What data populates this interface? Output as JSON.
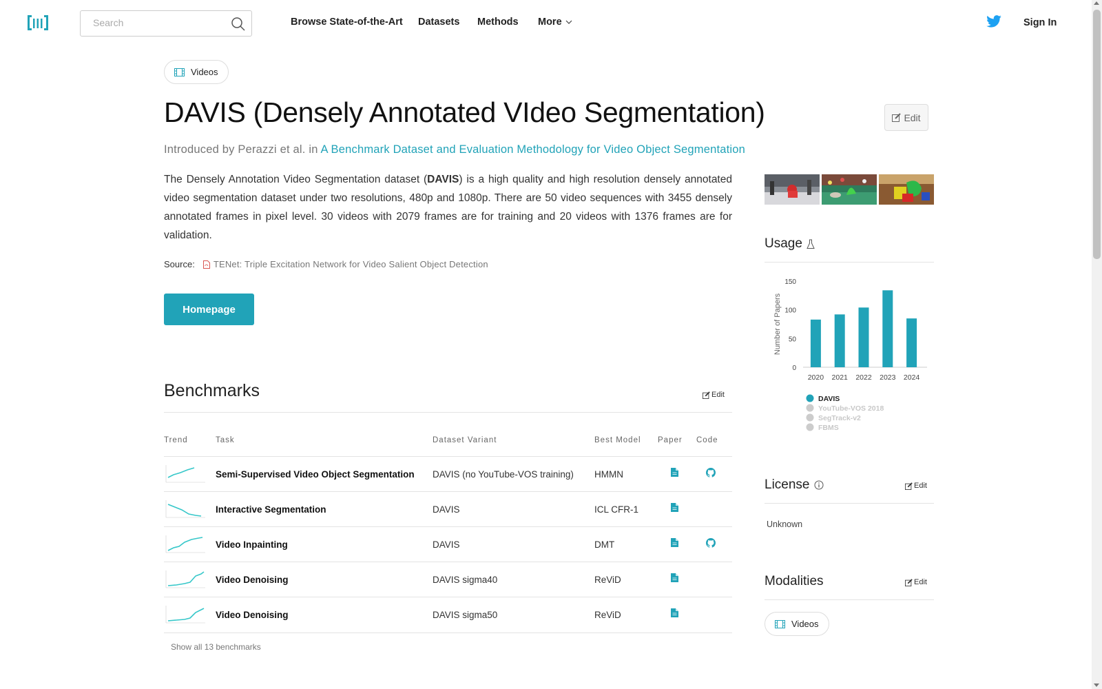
{
  "nav": {
    "search_placeholder": "Search",
    "links": [
      "Browse State-of-the-Art",
      "Datasets",
      "Methods",
      "More"
    ],
    "sign_in": "Sign In"
  },
  "modality_pill": "Videos",
  "title": "DAVIS (Densely Annotated VIdeo Segmentation)",
  "edit_label": "Edit",
  "introduced": {
    "prefix": "Introduced by Perazzi et al. in",
    "paper": "A Benchmark Dataset and Evaluation Methodology for Video Object Segmentation"
  },
  "description": {
    "before": "The Densely Annotation Video Segmentation dataset (",
    "bold": "DAVIS",
    "after": ") is a high quality and high resolution densely annotated video segmentation dataset under two resolutions, 480p and 1080p. There are 50 video sequences with 3455 densely annotated frames in pixel level. 30 videos with 2079 frames are for training and 20 videos with 1376 frames are for validation."
  },
  "source": {
    "label": "Source:",
    "link": "TENet: Triple Excitation Network for Video Salient Object Detection"
  },
  "homepage": "Homepage",
  "benchmarks": {
    "heading": "Benchmarks",
    "edit": "Edit",
    "columns": [
      "Trend",
      "Task",
      "Dataset Variant",
      "Best Model",
      "Paper",
      "Code"
    ],
    "rows": [
      {
        "task": "Semi-Supervised Video Object Segmentation",
        "variant": "DAVIS (no YouTube-VOS training)",
        "model": "HMMN",
        "code": true
      },
      {
        "task": "Interactive Segmentation",
        "variant": "DAVIS",
        "model": "ICL CFR-1",
        "code": false
      },
      {
        "task": "Video Inpainting",
        "variant": "DAVIS",
        "model": "DMT",
        "code": true
      },
      {
        "task": "Video Denoising",
        "variant": "DAVIS sigma40",
        "model": "ReViD",
        "code": false
      },
      {
        "task": "Video Denoising",
        "variant": "DAVIS sigma50",
        "model": "ReViD",
        "code": false
      }
    ],
    "show_all": "Show all 13 benchmarks"
  },
  "usage": {
    "heading": "Usage"
  },
  "license": {
    "heading": "License",
    "edit": "Edit",
    "value": "Unknown"
  },
  "modalities": {
    "heading": "Modalities",
    "edit": "Edit",
    "pill": "Videos"
  },
  "colors": {
    "accent": "#21a3b8",
    "twitter": "#1da1f2",
    "paper_icon": "#21a3b8"
  },
  "chart_data": {
    "type": "bar",
    "categories": [
      "2020",
      "2021",
      "2022",
      "2023",
      "2024"
    ],
    "values": [
      83,
      92,
      104,
      134,
      85
    ],
    "ylabel": "Number of Papers",
    "ylim": [
      0,
      150
    ],
    "yticks": [
      0,
      50,
      100,
      150
    ],
    "legend": [
      {
        "name": "DAVIS",
        "active": true
      },
      {
        "name": "YouTube-VOS 2018",
        "active": false
      },
      {
        "name": "SegTrack-v2",
        "active": false
      },
      {
        "name": "FBMS",
        "active": false
      }
    ]
  }
}
